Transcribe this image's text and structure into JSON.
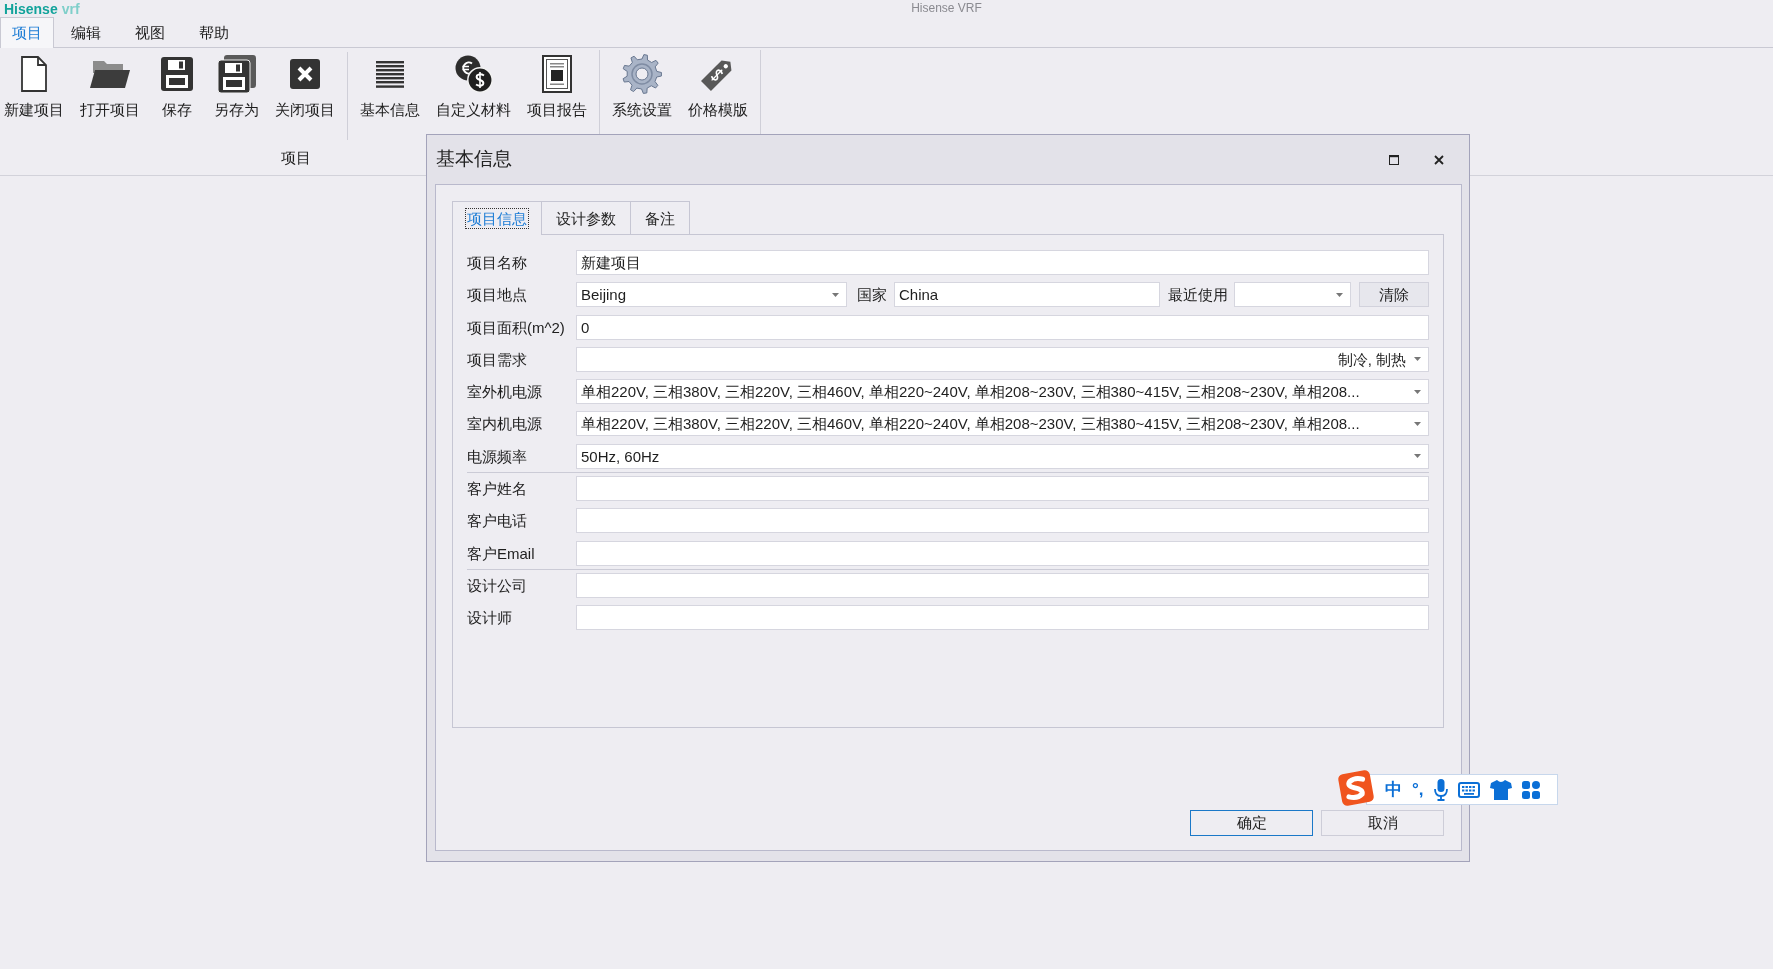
{
  "app": {
    "logo_brand": "Hisense",
    "logo_product": "vrf",
    "title": "Hisense VRF"
  },
  "menu_tabs": [
    {
      "label": "项目",
      "selected": true
    },
    {
      "label": "编辑",
      "selected": false
    },
    {
      "label": "视图",
      "selected": false
    },
    {
      "label": "帮助",
      "selected": false
    }
  ],
  "ribbon": {
    "groups": [
      {
        "label": "项目",
        "sections": [
          [
            {
              "label": "新建项目"
            },
            {
              "label": "打开项目"
            },
            {
              "label": "保存"
            },
            {
              "label": "另存为"
            },
            {
              "label": "关闭项目"
            }
          ],
          [
            {
              "label": "基本信息"
            },
            {
              "label": "自定义材料"
            },
            {
              "label": "项目报告"
            }
          ]
        ]
      },
      {
        "sections": [
          [
            {
              "label": "系统设置"
            },
            {
              "label": "价格模版"
            }
          ]
        ]
      }
    ]
  },
  "dialog": {
    "title": "基本信息",
    "tabs": [
      {
        "label": "项目信息",
        "selected": true
      },
      {
        "label": "设计参数",
        "selected": false
      },
      {
        "label": "备注",
        "selected": false
      }
    ],
    "sections": [
      {
        "rows": [
          {
            "kind": "text",
            "label": "项目名称",
            "value": "新建项目"
          },
          {
            "kind": "location",
            "label": "项目地点",
            "value": "Beijing",
            "country_label": "国家",
            "country": "China",
            "recent_label": "最近使用",
            "button": "清除"
          },
          {
            "kind": "text",
            "label": "项目面积(m^2)",
            "value": "0"
          },
          {
            "kind": "checklist",
            "label": "项目需求",
            "value": "制冷, 制热"
          },
          {
            "kind": "dropdown",
            "label": "室外机电源",
            "value": "单相220V, 三相380V, 三相220V, 三相460V, 单相220~240V, 单相208~230V, 三相380~415V, 三相208~230V, 单相208..."
          },
          {
            "kind": "dropdown",
            "label": "室内机电源",
            "value": "单相220V, 三相380V, 三相220V, 三相460V, 单相220~240V, 单相208~230V, 三相380~415V, 三相208~230V, 单相208..."
          },
          {
            "kind": "dropdown",
            "label": "电源频率",
            "value": "50Hz, 60Hz"
          }
        ]
      },
      {
        "rows": [
          {
            "kind": "text",
            "label": "客户姓名"
          },
          {
            "kind": "text",
            "label": "客户电话"
          },
          {
            "kind": "text",
            "label": "客户Email"
          }
        ]
      },
      {
        "rows": [
          {
            "kind": "text",
            "label": "设计公司"
          },
          {
            "kind": "text",
            "label": "设计师"
          }
        ]
      }
    ],
    "buttons": [
      {
        "label": "确定",
        "default": true
      },
      {
        "label": "取消",
        "default": false
      }
    ]
  },
  "ime_toolbar": {
    "mode": "中",
    "punctuation": "°,"
  }
}
